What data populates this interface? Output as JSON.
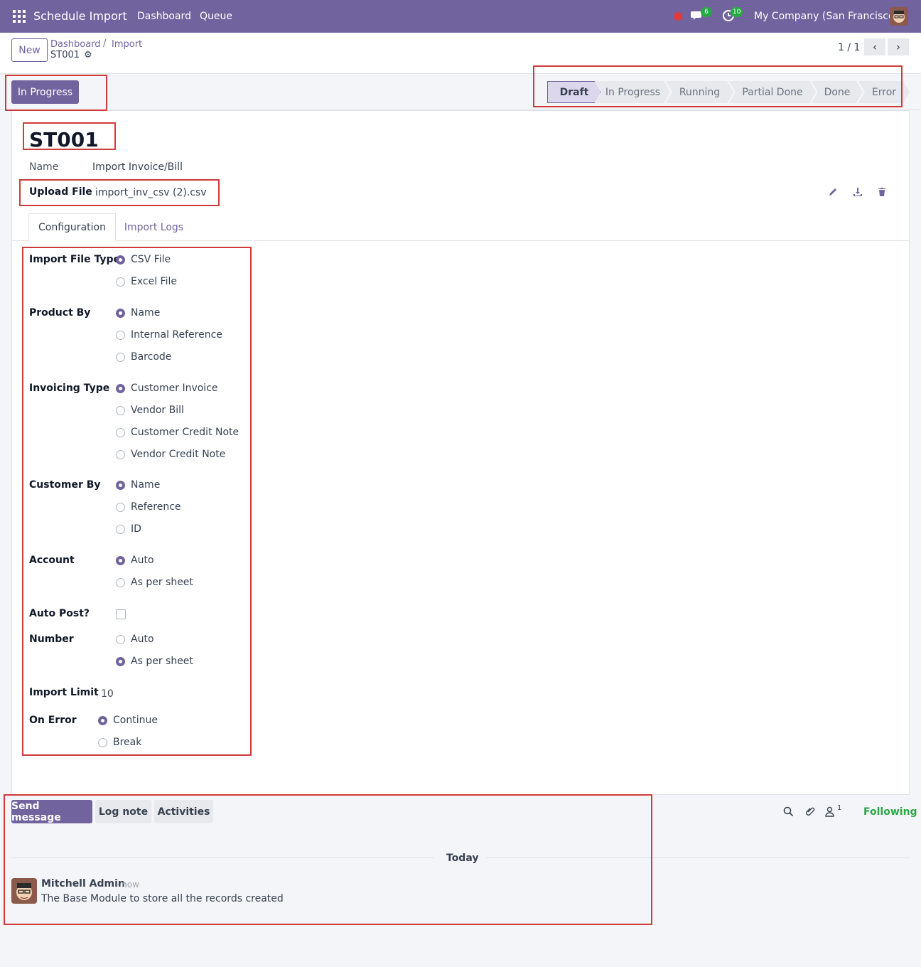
{
  "navbar": {
    "app_name": "Schedule Import",
    "menu": [
      "Dashboard",
      "Queue"
    ],
    "messages_badge": "6",
    "activities_badge": "10",
    "company": "My Company (San Francisco)"
  },
  "control_panel": {
    "new_label": "New",
    "breadcrumb": [
      "Dashboard",
      "Import"
    ],
    "record_title": "ST001",
    "pager": "1 / 1"
  },
  "statusbar": {
    "action_button": "In Progress",
    "stages": [
      "Draft",
      "In Progress",
      "Running",
      "Partial Done",
      "Done",
      "Error"
    ],
    "active_stage": "Draft"
  },
  "record": {
    "code": "ST001",
    "name_label": "Name",
    "name_value": "Import Invoice/Bill",
    "upload_label": "Upload File",
    "upload_value": "import_inv_csv (2).csv"
  },
  "tabs": [
    "Configuration",
    "Import Logs"
  ],
  "config": {
    "import_file_type": {
      "label": "Import File Type",
      "options": [
        "CSV File",
        "Excel File"
      ],
      "selected": "CSV File"
    },
    "product_by": {
      "label": "Product By",
      "options": [
        "Name",
        "Internal Reference",
        "Barcode"
      ],
      "selected": "Name"
    },
    "invoicing_type": {
      "label": "Invoicing Type",
      "options": [
        "Customer Invoice",
        "Vendor Bill",
        "Customer Credit Note",
        "Vendor Credit Note"
      ],
      "selected": "Customer Invoice"
    },
    "customer_by": {
      "label": "Customer By",
      "options": [
        "Name",
        "Reference",
        "ID"
      ],
      "selected": "Name"
    },
    "account": {
      "label": "Account",
      "options": [
        "Auto",
        "As per sheet"
      ],
      "selected": "Auto"
    },
    "auto_post": {
      "label": "Auto Post?",
      "checked": false
    },
    "number": {
      "label": "Number",
      "options": [
        "Auto",
        "As per sheet"
      ],
      "selected": "As per sheet"
    },
    "import_limit": {
      "label": "Import Limit",
      "value": "10"
    },
    "on_error": {
      "label": "On Error",
      "options": [
        "Continue",
        "Break"
      ],
      "selected": "Continue"
    }
  },
  "chatter": {
    "send_message": "Send message",
    "log_note": "Log note",
    "activities": "Activities",
    "followers_count": "1",
    "following": "Following",
    "date_separator": "Today",
    "message": {
      "author": "Mitchell Admin",
      "time": "- now",
      "body": "The Base Module to store all the records created"
    }
  },
  "colors": {
    "brand": "#71639e",
    "highlight": "#d03a3a",
    "following": "#28a745"
  }
}
